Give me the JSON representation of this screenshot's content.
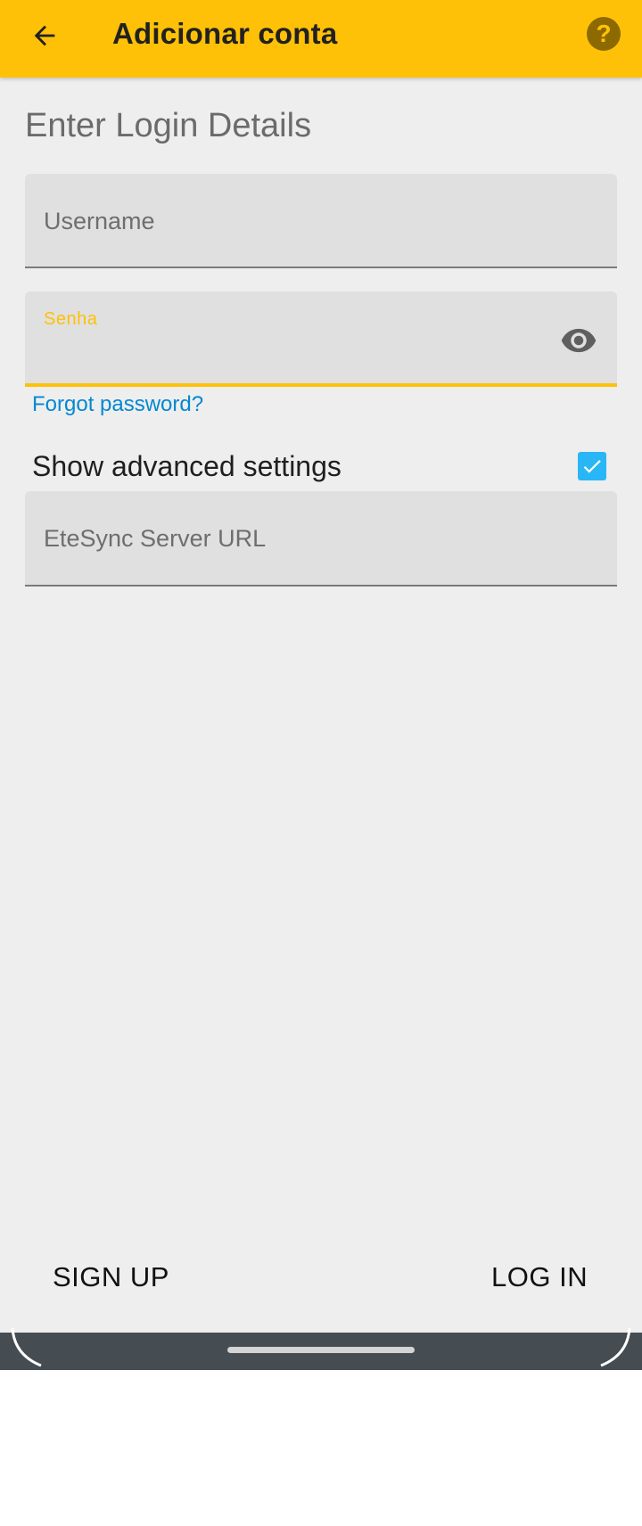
{
  "app_bar": {
    "title": "Adicionar conta",
    "back_icon": "arrow-left-icon",
    "help_icon": "help-circle-icon",
    "help_glyph": "?",
    "color": "#ffc107"
  },
  "form": {
    "section_title": "Enter Login Details",
    "username": {
      "placeholder": "Username",
      "value": ""
    },
    "password": {
      "label": "Senha",
      "value": "",
      "focused": true,
      "toggle_icon": "eye-icon"
    },
    "forgot_password_link": "Forgot password?",
    "advanced_settings": {
      "label": "Show advanced settings",
      "checked": true
    },
    "server_url": {
      "placeholder": "EteSync Server URL",
      "value": ""
    }
  },
  "actions": {
    "sign_up": "SIGN UP",
    "log_in": "LOG IN"
  },
  "colors": {
    "accent": "#ffc107",
    "link": "#0288d1",
    "checkbox": "#29b6f6",
    "background": "#eeeeee",
    "nav_bar": "#464d52"
  }
}
